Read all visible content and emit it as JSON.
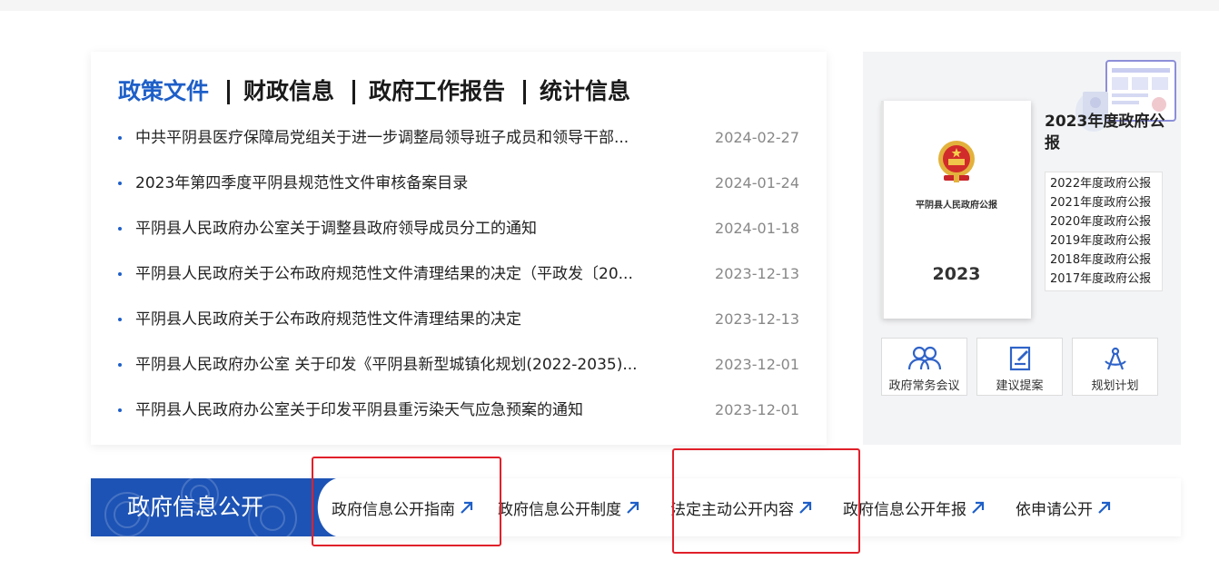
{
  "tabs": [
    {
      "label": "政策文件",
      "active": true
    },
    {
      "label": "财政信息",
      "active": false
    },
    {
      "label": "政府工作报告",
      "active": false
    },
    {
      "label": "统计信息",
      "active": false
    }
  ],
  "news": [
    {
      "title": "中共平阴县医疗保障局党组关于进一步调整局领导班子成员和领导干部...",
      "date": "2024-02-27"
    },
    {
      "title": "2023年第四季度平阴县规范性文件审核备案目录",
      "date": "2024-01-24"
    },
    {
      "title": "平阴县人民政府办公室关于调整县政府领导成员分工的通知",
      "date": "2024-01-18"
    },
    {
      "title": "平阴县人民政府关于公布政府规范性文件清理结果的决定（平政发〔20...",
      "date": "2023-12-13"
    },
    {
      "title": "平阴县人民政府关于公布政府规范性文件清理结果的决定",
      "date": "2023-12-13"
    },
    {
      "title": "平阴县人民政府办公室 关于印发《平阴县新型城镇化规划(2022-2035)...",
      "date": "2023-12-01"
    },
    {
      "title": "平阴县人民政府办公室关于印发平阴县重污染天气应急预案的通知",
      "date": "2023-12-01"
    }
  ],
  "gazette": {
    "heading": "2023年度政府公报",
    "book_title": "平阴县人民政府公报",
    "book_year": "2023",
    "years": [
      "2022年度政府公报",
      "2021年度政府公报",
      "2020年度政府公报",
      "2019年度政府公报",
      "2018年度政府公报",
      "2017年度政府公报"
    ]
  },
  "quick_links": [
    {
      "label": "政府常务会议",
      "icon": "people-icon"
    },
    {
      "label": "建议提案",
      "icon": "edit-note-icon"
    },
    {
      "label": "规划计划",
      "icon": "compass-icon"
    }
  ],
  "banner": {
    "label": "政府信息公开",
    "links": [
      "政府信息公开指南",
      "政府信息公开制度",
      "法定主动公开内容",
      "政府信息公开年报",
      "依申请公开"
    ]
  },
  "colors": {
    "accent": "#1e5fc8",
    "banner_bg": "#1d53b5",
    "highlight": "#e0202a"
  }
}
